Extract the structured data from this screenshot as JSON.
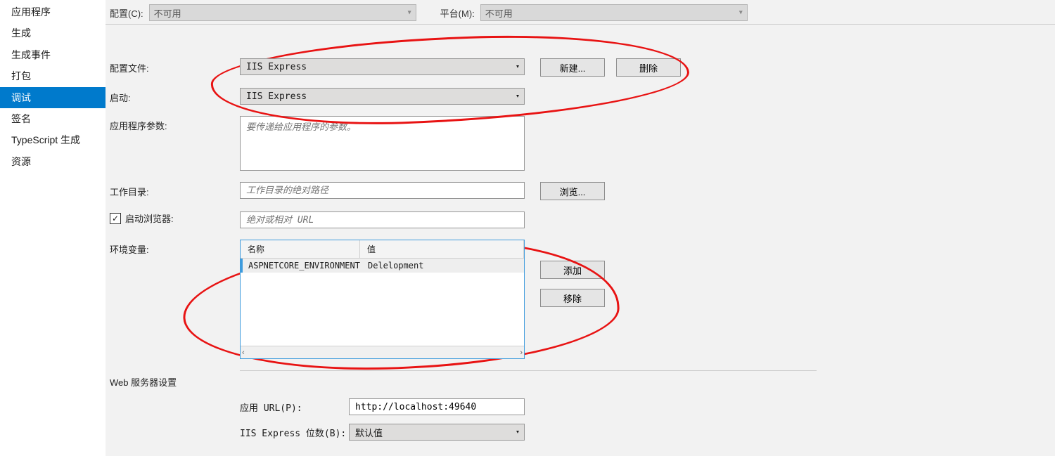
{
  "sidebar": {
    "items": [
      {
        "label": "应用程序"
      },
      {
        "label": "生成"
      },
      {
        "label": "生成事件"
      },
      {
        "label": "打包"
      },
      {
        "label": "调试",
        "selected": true
      },
      {
        "label": "签名"
      },
      {
        "label": "TypeScript 生成"
      },
      {
        "label": "资源"
      }
    ]
  },
  "top": {
    "config_label": "配置(C):",
    "config_value": "不可用",
    "platform_label": "平台(M):",
    "platform_value": "不可用"
  },
  "form": {
    "profile_label": "配置文件:",
    "profile_value": "IIS Express",
    "new_btn": "新建...",
    "delete_btn": "删除",
    "launch_label": "启动:",
    "launch_value": "IIS Express",
    "args_label": "应用程序参数:",
    "args_placeholder": "要传递给应用程序的参数。",
    "workdir_label": "工作目录:",
    "workdir_placeholder": "工作目录的绝对路径",
    "browse_btn": "浏览...",
    "launch_browser_label": "启动浏览器:",
    "launch_browser_placeholder": "绝对或相对 URL",
    "env_label": "环境变量:",
    "env_name_col": "名称",
    "env_value_col": "值",
    "env_rows": [
      {
        "name": "ASPNETCORE_ENVIRONMENT",
        "value": "Delelopment"
      }
    ],
    "add_btn": "添加",
    "remove_btn": "移除",
    "web_section": "Web 服务器设置",
    "app_url_label": "应用 URL(P):",
    "app_url_value": "http://localhost:49640",
    "bits_label": "IIS Express 位数(B):",
    "bits_value": "默认值"
  }
}
